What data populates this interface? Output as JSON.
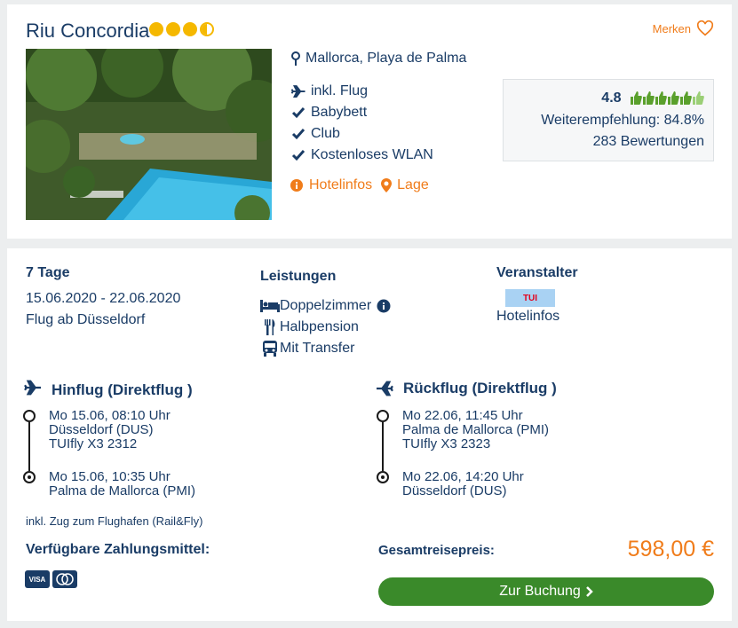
{
  "hotel": {
    "name": "Riu Concordia",
    "stars": 3.5,
    "merken_label": "Merken",
    "location": "Mallorca, Playa de Palma",
    "features": [
      {
        "icon": "plane-icon",
        "label": "inkl. Flug"
      },
      {
        "icon": "check-icon",
        "label": "Babybett"
      },
      {
        "icon": "check-icon",
        "label": "Club"
      },
      {
        "icon": "check-icon",
        "label": "Kostenloses WLAN"
      }
    ],
    "links": {
      "hotelinfos": "Hotelinfos",
      "lage": "Lage"
    },
    "rating": {
      "score": "4.8",
      "thumbs": 6,
      "recommend": "Weiterempfehlung: 84.8%",
      "reviews": "283 Bewertungen"
    }
  },
  "offer": {
    "duration": "7 Tage",
    "dates": "15.06.2020 - 22.06.2020",
    "departure": "Flug ab Düsseldorf",
    "services_title": "Leistungen",
    "services": [
      {
        "icon": "bed-icon",
        "label": "Doppelzimmer"
      },
      {
        "icon": "cutlery-icon",
        "label": "Halbpension"
      },
      {
        "icon": "bus-icon",
        "label": "Mit Transfer"
      }
    ],
    "operator_title": "Veranstalter",
    "operator_logo": "TUI",
    "operator_link": "Hotelinfos"
  },
  "outbound": {
    "title": "Hinflug (Direktflug )",
    "dep_time": "Mo 15.06, 08:10 Uhr",
    "dep_airport": "Düsseldorf (DUS)",
    "flight_no": "TUIfly X3 2312",
    "arr_time": "Mo 15.06, 10:35 Uhr",
    "arr_airport": "Palma de Mallorca (PMI)"
  },
  "return": {
    "title": "Rückflug (Direktflug )",
    "dep_time": "Mo 22.06, 11:45 Uhr",
    "dep_airport": "Palma de Mallorca (PMI)",
    "flight_no": "TUIfly X3 2323",
    "arr_time": "Mo 22.06, 14:20 Uhr",
    "arr_airport": "Düsseldorf (DUS)"
  },
  "rail_note": "inkl. Zug zum Flughafen (Rail&Fly)",
  "payment": {
    "title": "Verfügbare Zahlungsmittel:",
    "methods": [
      "VISA",
      "mastercard"
    ]
  },
  "total": {
    "label": "Gesamtreisepreis:",
    "price": "598,00 €"
  },
  "book_label": "Zur Buchung",
  "colors": {
    "primary": "#1a3c66",
    "accent": "#f07c1a",
    "button": "#3a8a2a",
    "star": "#f5b800",
    "thumb": "#5aa02c"
  }
}
